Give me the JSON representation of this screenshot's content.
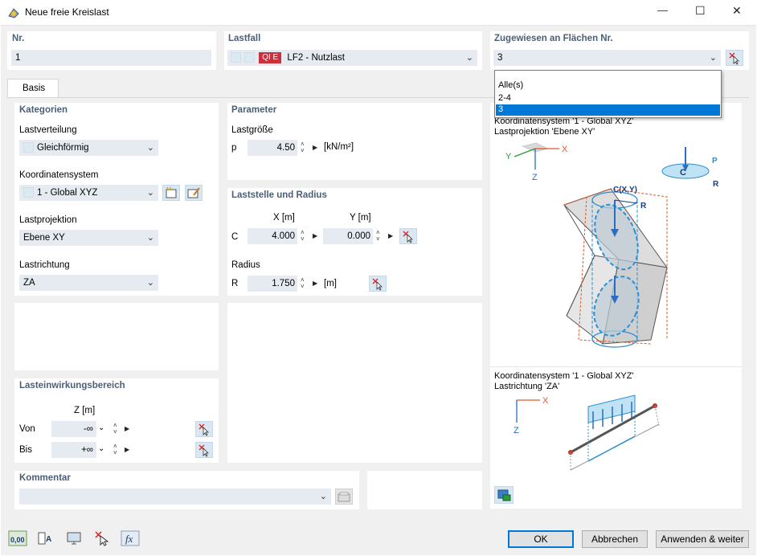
{
  "window": {
    "title": "Neue freie Kreislast",
    "minimize_glyph": "—",
    "maximize_glyph": "☐",
    "close_glyph": "✕"
  },
  "top": {
    "nr_label": "Nr.",
    "nr_value": "1",
    "lastfall_label": "Lastfall",
    "lastfall_badge": "QI E",
    "lastfall_value": "LF2 - Nutzlast",
    "zugewiesen_label": "Zugewiesen an Flächen Nr.",
    "zugewiesen_value": "3",
    "dropdown_options": [
      "Alle(s)",
      "2-4",
      "3"
    ],
    "dropdown_selected": 2
  },
  "tabs": {
    "basis": "Basis"
  },
  "kategorien": {
    "title": "Kategorien",
    "lastverteilung_label": "Lastverteilung",
    "lastverteilung_value": "Gleichförmig",
    "koordsys_label": "Koordinatensystem",
    "koordsys_value": "1 - Global XYZ",
    "lastprojektion_label": "Lastprojektion",
    "lastprojektion_value": "Ebene XY",
    "lastrichtung_label": "Lastrichtung",
    "lastrichtung_value": "ZA"
  },
  "parameter": {
    "title": "Parameter",
    "lastgroesse_label": "Lastgröße",
    "p_symbol": "p",
    "p_value": "4.50",
    "p_unit": "[kN/m²]"
  },
  "laststelle": {
    "title": "Laststelle und Radius",
    "x_header": "X [m]",
    "y_header": "Y [m]",
    "c_symbol": "C",
    "c_x": "4.000",
    "c_y": "0.000",
    "radius_label": "Radius",
    "r_symbol": "R",
    "r_value": "1.750",
    "r_unit": "[m]"
  },
  "lasteinwirkung": {
    "title": "Lasteinwirkungsbereich",
    "z_header": "Z [m]",
    "von_label": "Von",
    "von_value": "-∞",
    "bis_label": "Bis",
    "bis_value": "+∞"
  },
  "kommentar": {
    "title": "Kommentar",
    "value": ""
  },
  "preview": {
    "caption1_line1": "Koordinatensystem '1 - Global XYZ'",
    "caption1_line2": "Lastprojektion 'Ebene XY'",
    "caption2_line1": "Koordinatensystem '1 - Global XYZ'",
    "caption2_line2": "Lastrichtung 'ZA'",
    "axis_y": "Y",
    "axis_x": "X",
    "axis_z": "Z",
    "label_p": "P",
    "label_c": "C",
    "label_r": "R",
    "label_cxy": "C(X,Y)"
  },
  "footer": {
    "ok": "OK",
    "abbrechen": "Abbrechen",
    "anwenden": "Anwenden & weiter",
    "num_icon_text": "0,00"
  },
  "colors": {
    "accent": "#0078d7",
    "title_blue": "#4a5f76",
    "field_bg": "#e6ebf2",
    "badge_red": "#c8323c",
    "axis_orange": "#e0572a",
    "axis_green": "#2a9a3c",
    "axis_blue": "#2b6cc4",
    "load_blue": "#3aa0dc"
  }
}
